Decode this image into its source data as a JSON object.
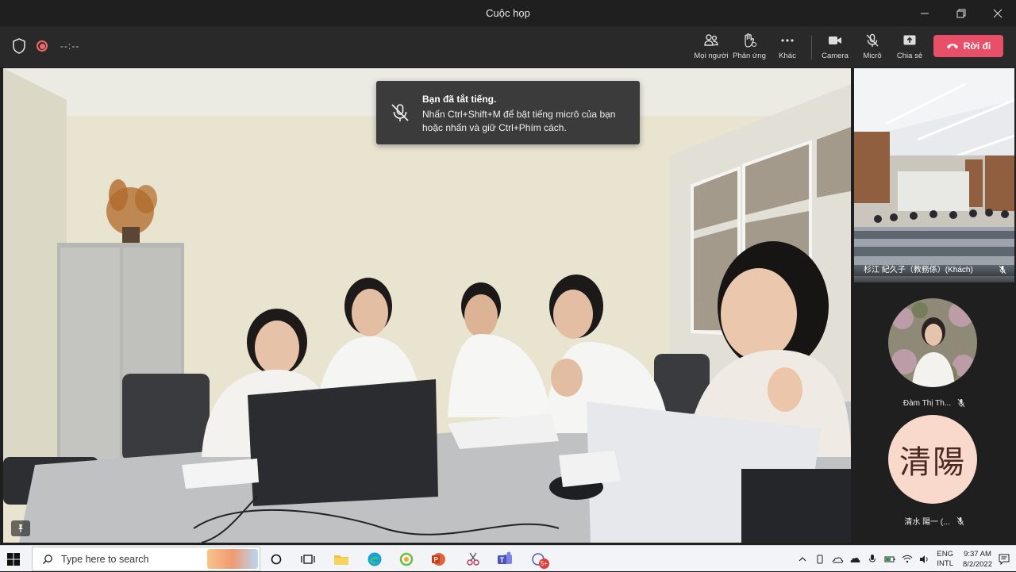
{
  "window": {
    "title": "Cuộc họp"
  },
  "toolbar": {
    "timer": "--:--",
    "buttons": [
      {
        "label": "Mọi người",
        "icon": "people-icon"
      },
      {
        "label": "Phản ứng",
        "icon": "reactions-icon"
      },
      {
        "label": "Khác",
        "icon": "more-icon"
      },
      {
        "label": "Camera",
        "icon": "camera-icon"
      },
      {
        "label": "Micrô",
        "icon": "mic-off-icon"
      },
      {
        "label": "Chia sẻ",
        "icon": "share-icon"
      }
    ],
    "leave_label": "Rời đi"
  },
  "toast": {
    "title": "Bạn đã tắt tiếng.",
    "body": "Nhấn Ctrl+Shift+M để bật tiếng micrô của bạn hoặc nhấn và giữ Ctrl+Phím cách."
  },
  "participants": [
    {
      "name": "杉江 紀久子（教務係）(Khách)",
      "muted": true
    },
    {
      "name": "Đàm Thị Th...",
      "muted": true
    },
    {
      "name": "清水 陽一 (...",
      "initials": "清陽",
      "muted": true
    }
  ],
  "taskbar": {
    "search_placeholder": "Type here to search",
    "lang_top": "ENG",
    "lang_bottom": "INTL",
    "time": "9:37 AM",
    "date": "8/2/2022",
    "teams_badge": "5+"
  },
  "colors": {
    "leave": "#e8506a",
    "toolbar_bg": "#292929",
    "toast_bg": "#3b3b3b"
  }
}
